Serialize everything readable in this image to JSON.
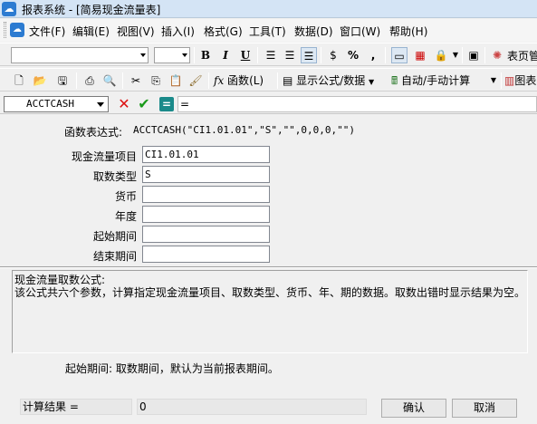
{
  "window": {
    "title": "报表系统 - [简易现金流量表]"
  },
  "menu": [
    "文件(F)",
    "编辑(E)",
    "视图(V)",
    "插入(I)",
    "格式(G)",
    "工具(T)",
    "数据(D)",
    "窗口(W)",
    "帮助(H)"
  ],
  "toolbar": {
    "bold": "B",
    "italic": "I",
    "underline": "U",
    "percent": "%",
    "comma": ",",
    "page_label": "表页管",
    "fx_label": "函数",
    "fx_shortcut": "(L)",
    "show_formula_label": "显示公式/数据",
    "calc_label": "自动/手动计算",
    "chart_label": "图表"
  },
  "formula_bar": {
    "cell_ref": "ACCTCASH",
    "formula": "="
  },
  "dialog": {
    "expr_label": "函数表达式:",
    "expr_value": "ACCTCASH(\"CI1.01.01\",\"S\",\"\",0,0,0,\"\")",
    "fields": [
      {
        "label": "现金流量项目",
        "value": "CI1.01.01"
      },
      {
        "label": "取数类型",
        "value": "S"
      },
      {
        "label": "货币",
        "value": ""
      },
      {
        "label": "年度",
        "value": ""
      },
      {
        "label": "起始期间",
        "value": ""
      },
      {
        "label": "结束期间",
        "value": ""
      }
    ],
    "help_title": "现金流量取数公式:",
    "help_text": "该公式共六个参数，计算指定现金流量项目、取数类型、货币、年、期的数据。取数出错时显示结果为空。",
    "param_hint": "起始期间:  取数期间，默认为当前报表期间。",
    "result_label": "计算结果 =",
    "result_value": "0",
    "ok_label": "确认",
    "cancel_label": "取消"
  }
}
